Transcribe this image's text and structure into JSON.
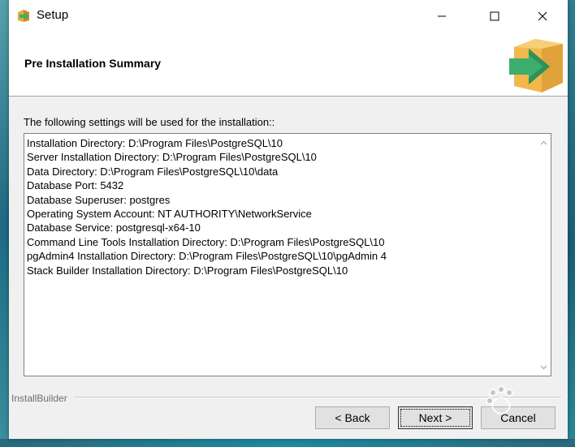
{
  "window": {
    "title": "Setup",
    "icon": "installer-box-icon",
    "controls": {
      "minimize": "minimize-icon",
      "maximize": "maximize-icon",
      "close": "close-icon"
    }
  },
  "header": {
    "title": "Pre Installation Summary",
    "logo": "installer-arrow-box-icon"
  },
  "intro": "The following settings will be used for the installation::",
  "summary": {
    "lines": [
      "Installation Directory: D:\\Program Files\\PostgreSQL\\10",
      "Server Installation Directory: D:\\Program Files\\PostgreSQL\\10",
      "Data Directory: D:\\Program Files\\PostgreSQL\\10\\data",
      "Database Port: 5432",
      "Database Superuser: postgres",
      "Operating System Account: NT AUTHORITY\\NetworkService",
      "Database Service: postgresql-x64-10",
      "Command Line Tools Installation Directory: D:\\Program Files\\PostgreSQL\\10",
      "pgAdmin4 Installation Directory: D:\\Program Files\\PostgreSQL\\10\\pgAdmin 4",
      "Stack Builder Installation Directory: D:\\Program Files\\PostgreSQL\\10"
    ]
  },
  "footer": {
    "brand": "InstallBuilder",
    "back_label": "< Back",
    "next_label": "Next >",
    "cancel_label": "Cancel"
  },
  "colors": {
    "header_bg": "#ffffff",
    "window_bg": "#f0f0f0",
    "button_bg": "#e1e1e1",
    "logo_box": "#f2b84b",
    "logo_arrow": "#3cae6e"
  }
}
